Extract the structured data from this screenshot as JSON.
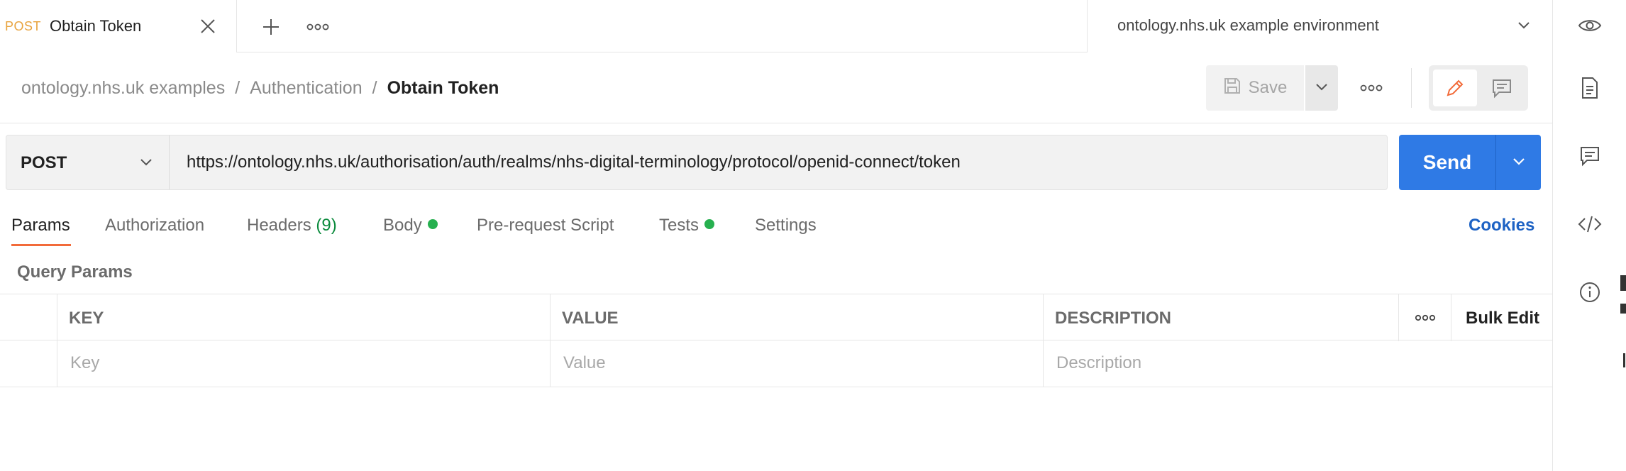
{
  "tab": {
    "method": "POST",
    "title": "Obtain Token"
  },
  "environment": {
    "selected": "ontology.nhs.uk example environment"
  },
  "breadcrumb": [
    "ontology.nhs.uk examples",
    "Authentication",
    "Obtain Token"
  ],
  "toolbar": {
    "save_label": "Save"
  },
  "request": {
    "method": "POST",
    "url": "https://ontology.nhs.uk/authorisation/auth/realms/nhs-digital-terminology/protocol/openid-connect/token",
    "send_label": "Send"
  },
  "subtabs": [
    {
      "label": "Params"
    },
    {
      "label": "Authorization"
    },
    {
      "label": "Headers",
      "count": "(9)"
    },
    {
      "label": "Body"
    },
    {
      "label": "Pre-request Script"
    },
    {
      "label": "Tests"
    },
    {
      "label": "Settings"
    }
  ],
  "cookies_label": "Cookies",
  "section_title": "Query Params",
  "params_table": {
    "headers": [
      "KEY",
      "VALUE",
      "DESCRIPTION"
    ],
    "bulk_edit_label": "Bulk Edit",
    "placeholders": {
      "key": "Key",
      "value": "Value",
      "description": "Description"
    }
  },
  "colors": {
    "accent": "#f26b3a",
    "send": "#2f7ae5",
    "link": "#1d62c4",
    "status_dot": "#26b04f",
    "method_tab": "#e8a33d"
  },
  "icons": [
    "close-icon",
    "plus-icon",
    "more-icon",
    "chevron-down-icon",
    "eye-icon",
    "document-icon",
    "comment-icon",
    "code-icon",
    "info-icon",
    "save-icon",
    "pencil-icon"
  ]
}
